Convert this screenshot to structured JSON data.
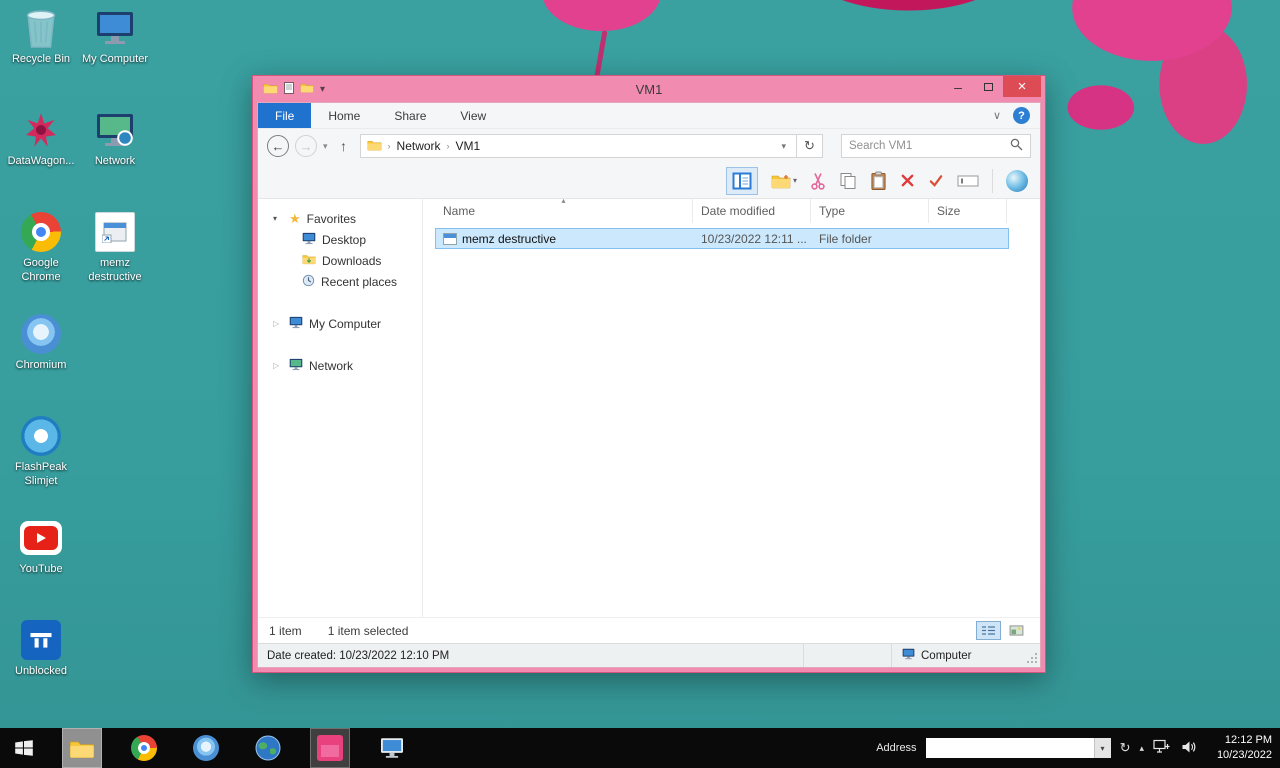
{
  "glyphs": {
    "minimize": "–",
    "close": "×",
    "back": "←",
    "forward": "→",
    "up": "↑",
    "refresh": "↻",
    "dropdown": "▾",
    "crumb_sep": "›",
    "expander_expanded": "▾",
    "expander_collapsed": "▷",
    "ribbon_chevron": "∨",
    "help": "?",
    "star": "★",
    "caret_up": "▴"
  },
  "desktop": {
    "col1": [
      {
        "label": "Recycle Bin"
      },
      {
        "label": "DataWagon..."
      },
      {
        "label": "Google Chrome"
      },
      {
        "label": "Chromium"
      },
      {
        "label": "FlashPeak Slimjet"
      },
      {
        "label": "YouTube"
      },
      {
        "label": "Unblocked"
      }
    ],
    "col2": [
      {
        "label": "My Computer"
      },
      {
        "label": "Network"
      },
      {
        "label": "memz destructive"
      }
    ]
  },
  "window": {
    "title": "VM1",
    "tabs": {
      "file": "File",
      "home": "Home",
      "share": "Share",
      "view": "View"
    },
    "address": {
      "crumb1": "Network",
      "crumb2": "VM1",
      "search_placeholder": "Search VM1"
    },
    "nav": {
      "favorites": "Favorites",
      "desktop": "Desktop",
      "downloads": "Downloads",
      "recent": "Recent places",
      "computer": "My Computer",
      "network": "Network"
    },
    "list": {
      "col_name": "Name",
      "col_date": "Date modified",
      "col_type": "Type",
      "col_size": "Size",
      "row": {
        "name": "memz destructive",
        "date": "10/23/2022 12:11 ...",
        "type": "File folder",
        "size": ""
      }
    },
    "status": {
      "count": "1 item",
      "selected": "1 item selected",
      "created": "Date created: 10/23/2022 12:10 PM",
      "location": "Computer"
    }
  },
  "taskbar": {
    "address_label": "Address",
    "time": "12:12 PM",
    "date": "10/23/2022"
  }
}
